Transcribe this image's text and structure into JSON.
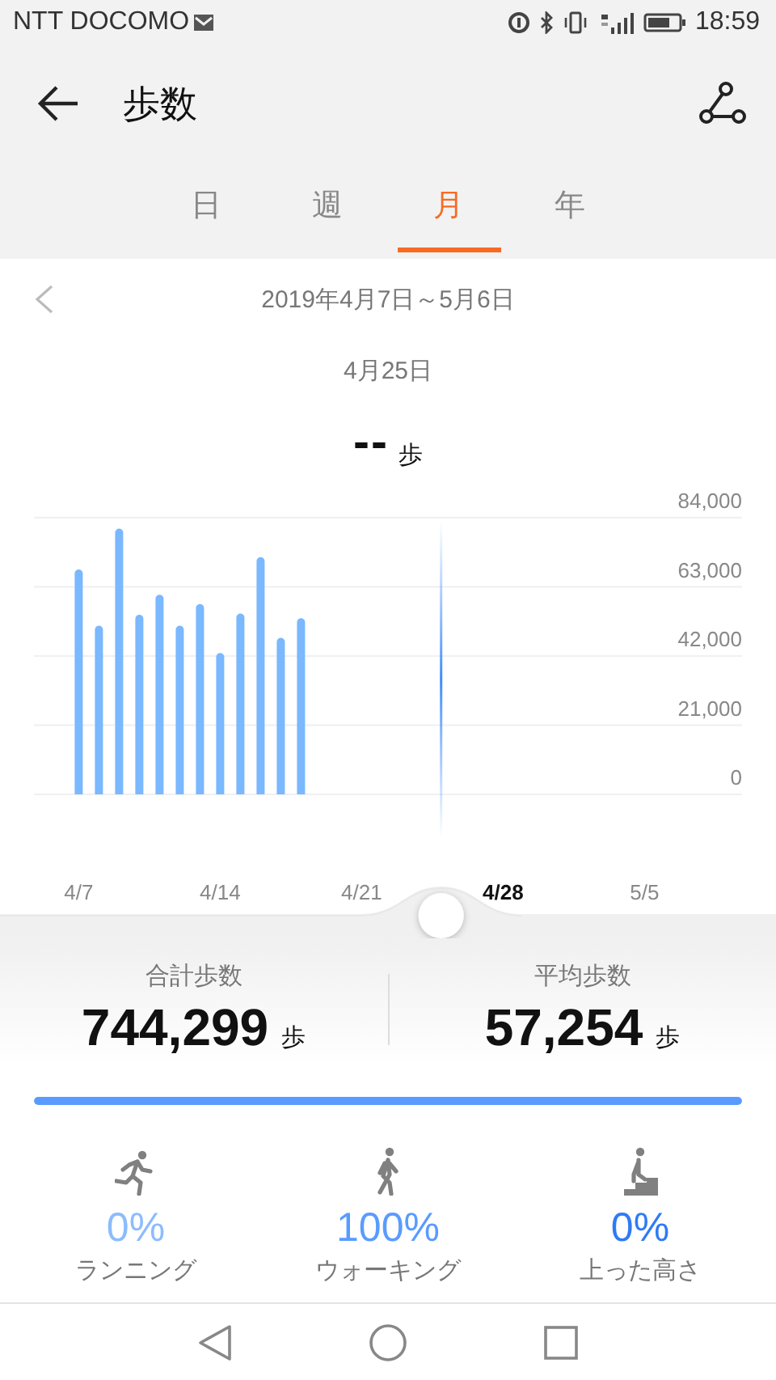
{
  "status_bar": {
    "carrier": "NTT DOCOMO",
    "time": "18:59"
  },
  "header": {
    "title": "歩数"
  },
  "tabs": [
    {
      "label": "日",
      "selected": false
    },
    {
      "label": "週",
      "selected": false
    },
    {
      "label": "月",
      "selected": true
    },
    {
      "label": "年",
      "selected": false
    }
  ],
  "period": {
    "range": "2019年4月7日～5月6日",
    "selected_day": "4月25日",
    "value": "--",
    "unit": "歩"
  },
  "chart": {
    "chart_data": {
      "type": "bar",
      "categories": [
        "4/7",
        null,
        null,
        null,
        null,
        null,
        null,
        "4/14",
        null,
        null,
        null,
        null,
        null,
        null,
        "4/21",
        null,
        null,
        null,
        null,
        null,
        null,
        "4/28",
        null,
        null,
        null,
        null,
        null,
        null,
        "5/5",
        null
      ],
      "values": [
        68300,
        51200,
        80700,
        54500,
        60600,
        51200,
        57800,
        42900,
        54900,
        72000,
        47500,
        53500,
        null,
        null,
        null,
        null,
        null,
        null,
        null,
        null,
        null,
        null,
        null,
        null,
        null,
        null,
        null,
        null,
        null,
        null
      ],
      "ylim": [
        0,
        84000
      ],
      "grid": true,
      "yticks": [
        {
          "value": 0,
          "label": "0"
        },
        {
          "value": 21000,
          "label": "21,000"
        },
        {
          "value": 42000,
          "label": "42,000"
        },
        {
          "value": 63000,
          "label": "63,000"
        },
        {
          "value": 84000,
          "label": "84,000"
        }
      ]
    },
    "x_label_states": [
      {
        "selected": false
      },
      {
        "selected": false
      },
      {
        "selected": false
      },
      {
        "selected": true
      },
      {
        "selected": false
      }
    ],
    "scrubber": {
      "level": 0.575
    }
  },
  "summary": {
    "items": [
      {
        "label": "合計歩数",
        "value": "744,299",
        "unit": "歩"
      },
      {
        "label": "平均歩数",
        "value": "57,254",
        "unit": "歩"
      }
    ],
    "bar": {
      "level": 1
    }
  },
  "activities": [
    {
      "kind": "running",
      "percent": "0%",
      "label": "ランニング",
      "color": "#8cbcff"
    },
    {
      "kind": "walking",
      "percent": "100%",
      "label": "ウォーキング",
      "color": "#5a9bff"
    },
    {
      "kind": "climbing",
      "percent": "0%",
      "label": "上った高さ",
      "color": "#2f7bf5"
    }
  ]
}
